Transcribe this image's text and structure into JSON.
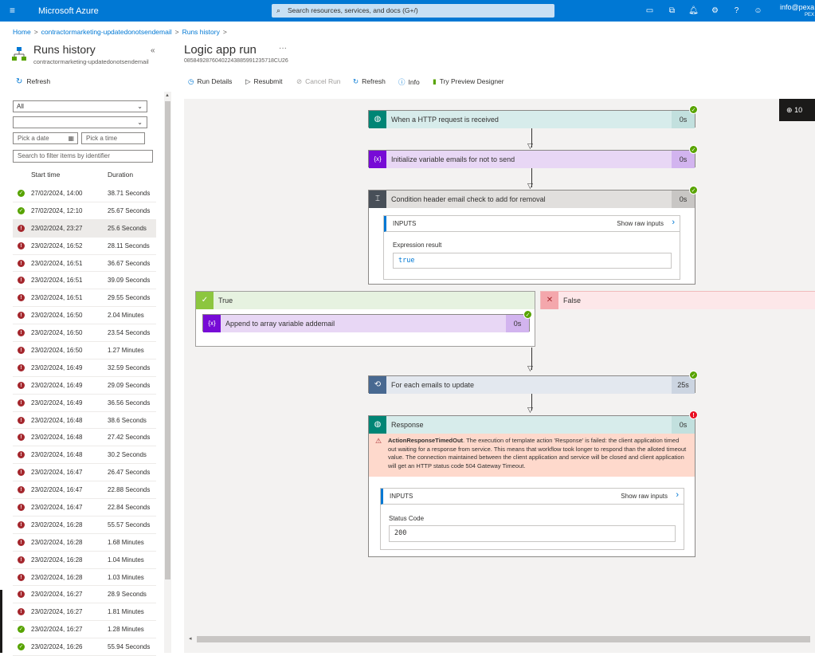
{
  "topbar": {
    "brand": "Microsoft Azure",
    "search_placeholder": "Search resources, services, and docs (G+/)",
    "user": "info@pexa",
    "tenant": "PEX"
  },
  "breadcrumb": [
    "Home",
    "contractormarketing-updatedonotsendemail",
    "Runs history"
  ],
  "left": {
    "title": "Runs history",
    "subtitle": "contractormarketing-updatedonotsendemail",
    "refresh": "Refresh",
    "status_filter": "All",
    "second_filter": "",
    "date_placeholder": "Pick a date",
    "time_placeholder": "Pick a time",
    "filter_placeholder": "Search to filter items by identifier",
    "col_start": "Start time",
    "col_duration": "Duration",
    "runs": [
      {
        "status": "ok",
        "time": "27/02/2024, 14:00",
        "duration": "38.71 Seconds"
      },
      {
        "status": "ok",
        "time": "27/02/2024, 12:10",
        "duration": "25.67 Seconds"
      },
      {
        "status": "err",
        "time": "23/02/2024, 23:27",
        "duration": "25.6 Seconds"
      },
      {
        "status": "err",
        "time": "23/02/2024, 16:52",
        "duration": "28.11 Seconds"
      },
      {
        "status": "err",
        "time": "23/02/2024, 16:51",
        "duration": "36.67 Seconds"
      },
      {
        "status": "err",
        "time": "23/02/2024, 16:51",
        "duration": "39.09 Seconds"
      },
      {
        "status": "err",
        "time": "23/02/2024, 16:51",
        "duration": "29.55 Seconds"
      },
      {
        "status": "err",
        "time": "23/02/2024, 16:50",
        "duration": "2.04 Minutes"
      },
      {
        "status": "err",
        "time": "23/02/2024, 16:50",
        "duration": "23.54 Seconds"
      },
      {
        "status": "err",
        "time": "23/02/2024, 16:50",
        "duration": "1.27 Minutes"
      },
      {
        "status": "err",
        "time": "23/02/2024, 16:49",
        "duration": "32.59 Seconds"
      },
      {
        "status": "err",
        "time": "23/02/2024, 16:49",
        "duration": "29.09 Seconds"
      },
      {
        "status": "err",
        "time": "23/02/2024, 16:49",
        "duration": "36.56 Seconds"
      },
      {
        "status": "err",
        "time": "23/02/2024, 16:48",
        "duration": "38.6 Seconds"
      },
      {
        "status": "err",
        "time": "23/02/2024, 16:48",
        "duration": "27.42 Seconds"
      },
      {
        "status": "err",
        "time": "23/02/2024, 16:48",
        "duration": "30.2 Seconds"
      },
      {
        "status": "err",
        "time": "23/02/2024, 16:47",
        "duration": "26.47 Seconds"
      },
      {
        "status": "err",
        "time": "23/02/2024, 16:47",
        "duration": "22.88 Seconds"
      },
      {
        "status": "err",
        "time": "23/02/2024, 16:47",
        "duration": "22.84 Seconds"
      },
      {
        "status": "err",
        "time": "23/02/2024, 16:28",
        "duration": "55.57 Seconds"
      },
      {
        "status": "err",
        "time": "23/02/2024, 16:28",
        "duration": "1.68 Minutes"
      },
      {
        "status": "err",
        "time": "23/02/2024, 16:28",
        "duration": "1.04 Minutes"
      },
      {
        "status": "err",
        "time": "23/02/2024, 16:28",
        "duration": "1.03 Minutes"
      },
      {
        "status": "err",
        "time": "23/02/2024, 16:27",
        "duration": "28.9 Seconds"
      },
      {
        "status": "err",
        "time": "23/02/2024, 16:27",
        "duration": "1.81 Minutes"
      },
      {
        "status": "ok",
        "time": "23/02/2024, 16:27",
        "duration": "1.28 Minutes"
      },
      {
        "status": "ok",
        "time": "23/02/2024, 16:26",
        "duration": "55.94 Seconds"
      }
    ]
  },
  "main": {
    "title": "Logic app run",
    "run_id": "08584928760402243885991235718CU26",
    "commands": {
      "run_details": "Run Details",
      "resubmit": "Resubmit",
      "cancel_run": "Cancel Run",
      "refresh": "Refresh",
      "info": "Info",
      "preview": "Try Preview Designer"
    },
    "zoom": "10"
  },
  "flow": {
    "trigger": {
      "label": "When a HTTP request is received",
      "duration": "0s"
    },
    "init_var": {
      "label": "Initialize variable emails for not to send",
      "duration": "0s"
    },
    "condition": {
      "label": "Condition header email check to add for removal",
      "duration": "0s",
      "inputs_label": "INPUTS",
      "show_raw": "Show raw inputs",
      "field_label": "Expression result",
      "field_value": "true"
    },
    "true_branch": {
      "label": "True"
    },
    "false_branch": {
      "label": "False"
    },
    "append": {
      "label": "Append to array variable addemail",
      "duration": "0s"
    },
    "foreach": {
      "label": "For each emails to update",
      "duration": "25s"
    },
    "response": {
      "label": "Response",
      "duration": "0s",
      "error_title": "ActionResponseTimedOut",
      "error_text": ". The execution of template action 'Response' is failed: the client application timed out waiting for a response from service. This means that workflow took longer to respond than the alloted timeout value. The connection maintained between the client application and service will be closed and client application will get an HTTP status code 504 Gateway Timeout.",
      "inputs_label": "INPUTS",
      "show_raw": "Show raw inputs",
      "field_label": "Status Code",
      "field_value": "200"
    }
  },
  "colors": {
    "azure_blue": "#0078d4",
    "success": "#57a300",
    "failure": "#a4262c",
    "http_teal": "#008575",
    "variable_purple": "#770bd6",
    "condition_gray": "#484f58",
    "foreach_slate": "#486991"
  }
}
